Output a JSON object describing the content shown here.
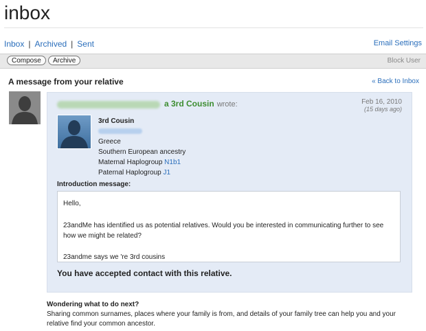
{
  "page": {
    "title": "inbox"
  },
  "nav": {
    "inbox": "Inbox",
    "archived": "Archived",
    "sent": "Sent",
    "separator": "|",
    "email_settings": "Email Settings"
  },
  "toolbar": {
    "compose": "Compose",
    "archive": "Archive",
    "block_user": "Block User"
  },
  "message": {
    "heading": "A message from your relative",
    "back_link": "« Back to Inbox",
    "relationship": "a 3rd Cousin",
    "wrote": "wrote:",
    "date": "Feb 16, 2010",
    "ago": "(15 days ago)",
    "profile": {
      "relation": "3rd Cousin",
      "country": "Greece",
      "ancestry": "Southern European ancestry",
      "maternal_label": "Maternal Haplogroup",
      "maternal_value": "N1b1",
      "paternal_label": "Paternal Haplogroup",
      "paternal_value": "J1"
    },
    "intro_heading": "Introduction message:",
    "intro": {
      "greeting": "Hello,",
      "body": "23andMe has identified us as potential relatives. Would you be interested in communicating further to see how we might be related?",
      "footer": "23andme says we 're 3rd cousins"
    },
    "accepted": "You have accepted contact with this relative."
  },
  "next_steps": {
    "heading": "Wondering what to do next?",
    "text": "Sharing common surnames, places where your family is from, and details of your family tree can help you and your relative find your common ancestor."
  },
  "icons": {
    "avatar": "person-silhouette-icon"
  },
  "colors": {
    "link": "#2a6ebb",
    "relationship": "#3d8d31",
    "panel_bg": "#e4ebf6"
  }
}
